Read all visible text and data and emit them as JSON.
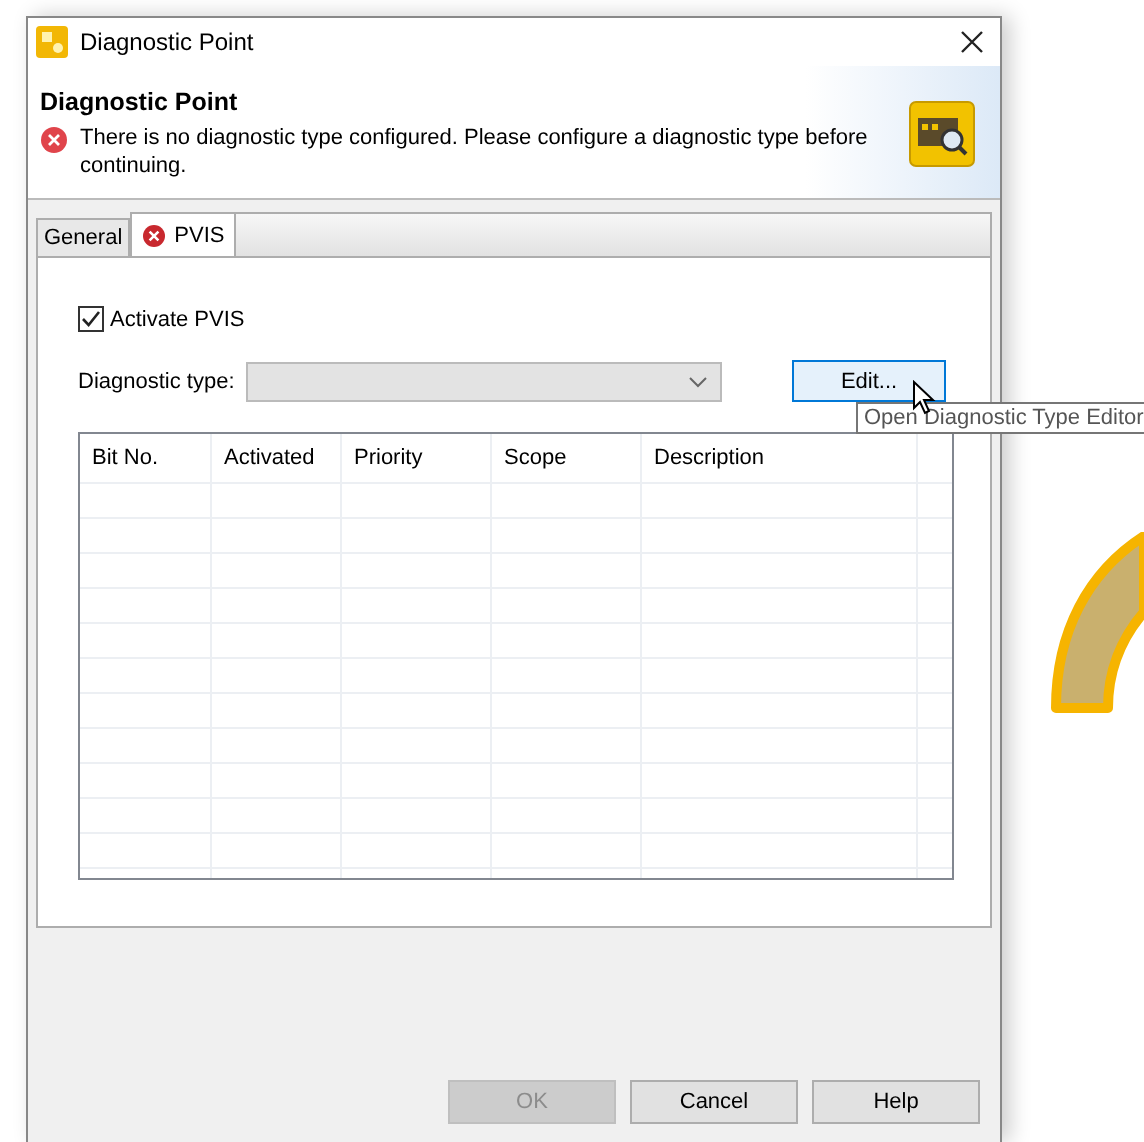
{
  "window": {
    "title": "Diagnostic Point"
  },
  "header": {
    "title": "Diagnostic Point",
    "message": "There is no diagnostic type configured. Please configure a diagnostic type before continuing."
  },
  "tabs": [
    {
      "label": "General",
      "selected": false,
      "error": false
    },
    {
      "label": "PVIS",
      "selected": true,
      "error": true
    }
  ],
  "activate": {
    "label": "Activate PVIS",
    "checked": true
  },
  "diagnostic_type": {
    "label": "Diagnostic type:",
    "disabled": true
  },
  "edit_button": {
    "label": "Edit...",
    "hovered": true
  },
  "tooltip": "Open Diagnostic Type Editor",
  "table": {
    "columns": [
      "Bit No.",
      "Activated",
      "Priority",
      "Scope",
      "Description"
    ]
  },
  "buttons": [
    {
      "label": "OK",
      "disabled": true
    },
    {
      "label": "Cancel",
      "disabled": false
    },
    {
      "label": "Help",
      "disabled": false
    }
  ]
}
